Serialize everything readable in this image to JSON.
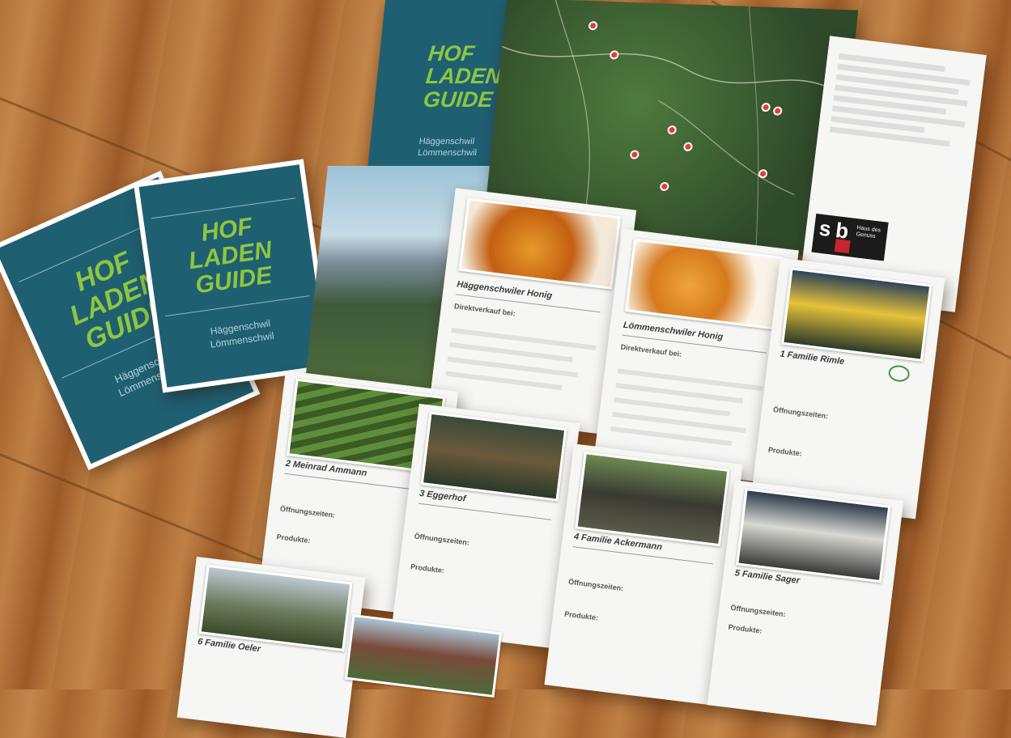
{
  "booklets": [
    {
      "title_line1": "HOF",
      "title_line2": "LADEN",
      "title_line3": "GUIDE",
      "sub_line1": "Häggenschwil",
      "sub_line2": "Lömmenschwil"
    },
    {
      "title_line1": "HOF",
      "title_line2": "LADEN",
      "title_line3": "GUIDE",
      "sub_line1": "Häggenschwil",
      "sub_line2": "Lömmenschwil"
    }
  ],
  "sheet": {
    "cover": {
      "title_line1": "HOF",
      "title_line2": "LADEN",
      "title_line3": "GUIDE",
      "sub_line1": "Häggenschwil",
      "sub_line2": "Lömmenschwil"
    },
    "logo": {
      "letters_top": "sb",
      "tagline": "Haus des Genuss"
    },
    "honey_panels": [
      {
        "title": "Häggenschwiler Honig",
        "label": "Direktverkauf bei:"
      },
      {
        "title": "Lömmenschwiler Honig",
        "label": "Direktverkauf bei:"
      }
    ],
    "farms": [
      {
        "title": "1 Familie Rimle",
        "label_hours": "Öffnungszeiten:",
        "label_products": "Produkte:"
      },
      {
        "title": "2 Meinrad Ammann",
        "label_hours": "Öffnungszeiten:",
        "label_products": "Produkte:"
      },
      {
        "title": "3 Eggerhof",
        "label_hours": "Öffnungszeiten:",
        "label_products": "Produkte:"
      },
      {
        "title": "4 Familie Ackermann",
        "label_hours": "Öffnungszeiten:",
        "label_products": "Produkte:"
      },
      {
        "title": "5 Familie Sager",
        "label_hours": "Öffnungszeiten:",
        "label_products": "Produkte:"
      },
      {
        "title": "6 Familie Oeler"
      }
    ]
  },
  "colors": {
    "wood": "#b0723a",
    "cover": "#1f5f72",
    "title_green": "#8ec63f",
    "pin": "#e53b3b",
    "map": "#2f4a2a"
  },
  "icons": [
    "map-pin-icon",
    "honey-jar-icon",
    "bio-logo-icon"
  ]
}
